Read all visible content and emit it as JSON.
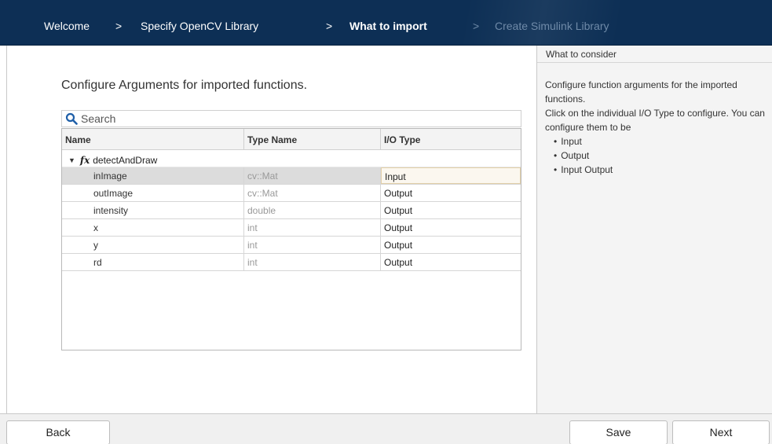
{
  "breadcrumb": {
    "items": [
      {
        "label": "Welcome"
      },
      {
        "label": "Specify OpenCV Library"
      },
      {
        "label": "What to import"
      },
      {
        "label": "Create Simulink Library"
      }
    ],
    "separator": ">"
  },
  "main": {
    "heading": "Configure Arguments for imported functions.",
    "search": {
      "placeholder": "Search",
      "value": ""
    },
    "table": {
      "columns": [
        "Name",
        "Type Name",
        "I/O Type"
      ],
      "function_name": "detectAndDraw",
      "function_prefix": "fx",
      "rows": [
        {
          "name": "inImage",
          "type": "cv::Mat",
          "io": "Input"
        },
        {
          "name": "outImage",
          "type": "cv::Mat",
          "io": "Output"
        },
        {
          "name": "intensity",
          "type": "double",
          "io": "Output"
        },
        {
          "name": "x",
          "type": "int",
          "io": "Output"
        },
        {
          "name": "y",
          "type": "int",
          "io": "Output"
        },
        {
          "name": "rd",
          "type": "int",
          "io": "Output"
        }
      ]
    }
  },
  "help": {
    "title": "What to consider",
    "para1": "Configure function arguments for the imported functions.",
    "para2": "Click on the individual I/O Type to configure. You can configure them to be",
    "options": [
      "Input",
      "Output",
      "Input Output"
    ]
  },
  "footer": {
    "back": "Back",
    "save": "Save",
    "next": "Next"
  },
  "colors": {
    "header_bg": "#0d2f55",
    "selected_row": "#dcdcdc"
  }
}
